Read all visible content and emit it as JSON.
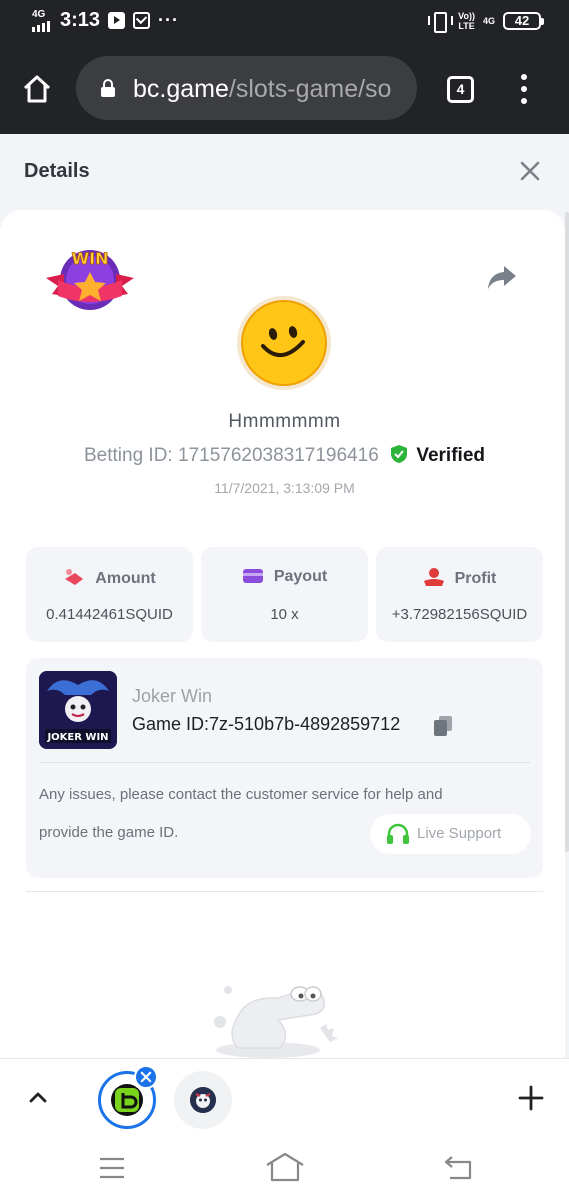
{
  "status_bar": {
    "network": "4G",
    "time": "3:13",
    "volte_top": "Vo))",
    "volte_bottom": "LTE",
    "network_right": "4G",
    "battery": "42"
  },
  "browser": {
    "url_host": "bc.game",
    "url_path": "/slots-game/so",
    "tab_count": "4"
  },
  "details": {
    "title": "Details",
    "username": "Hmmmmmm",
    "betting_id_label": "Betting ID:",
    "betting_id": "1715762038317196416",
    "verified": "Verified",
    "timestamp": "11/7/2021, 3:13:09 PM"
  },
  "stats": [
    {
      "label": "Amount",
      "value": "0.41442461SQUID",
      "icon": "amount-icon",
      "color": "#e8475e"
    },
    {
      "label": "Payout",
      "value": "10 x",
      "icon": "payout-card-icon",
      "color": "#8b4ddb"
    },
    {
      "label": "Profit",
      "value": "+3.72982156SQUID",
      "icon": "profit-icon",
      "color": "#e03a3a"
    }
  ],
  "game": {
    "name": "Joker Win",
    "thumb_text": "JOKER WIN",
    "game_id_label": "Game ID:",
    "game_id": "7z-510b7b-4892859712",
    "help_line1": "Any issues, please contact the customer service for help and",
    "help_line2": "provide the game ID.",
    "live_support": "Live Support",
    "support_color": "#3fc43a"
  },
  "badge": {
    "text": "WIN"
  },
  "colors": {
    "verified_shield": "#2bb33a",
    "tab_active_ring": "#1a73e8"
  }
}
